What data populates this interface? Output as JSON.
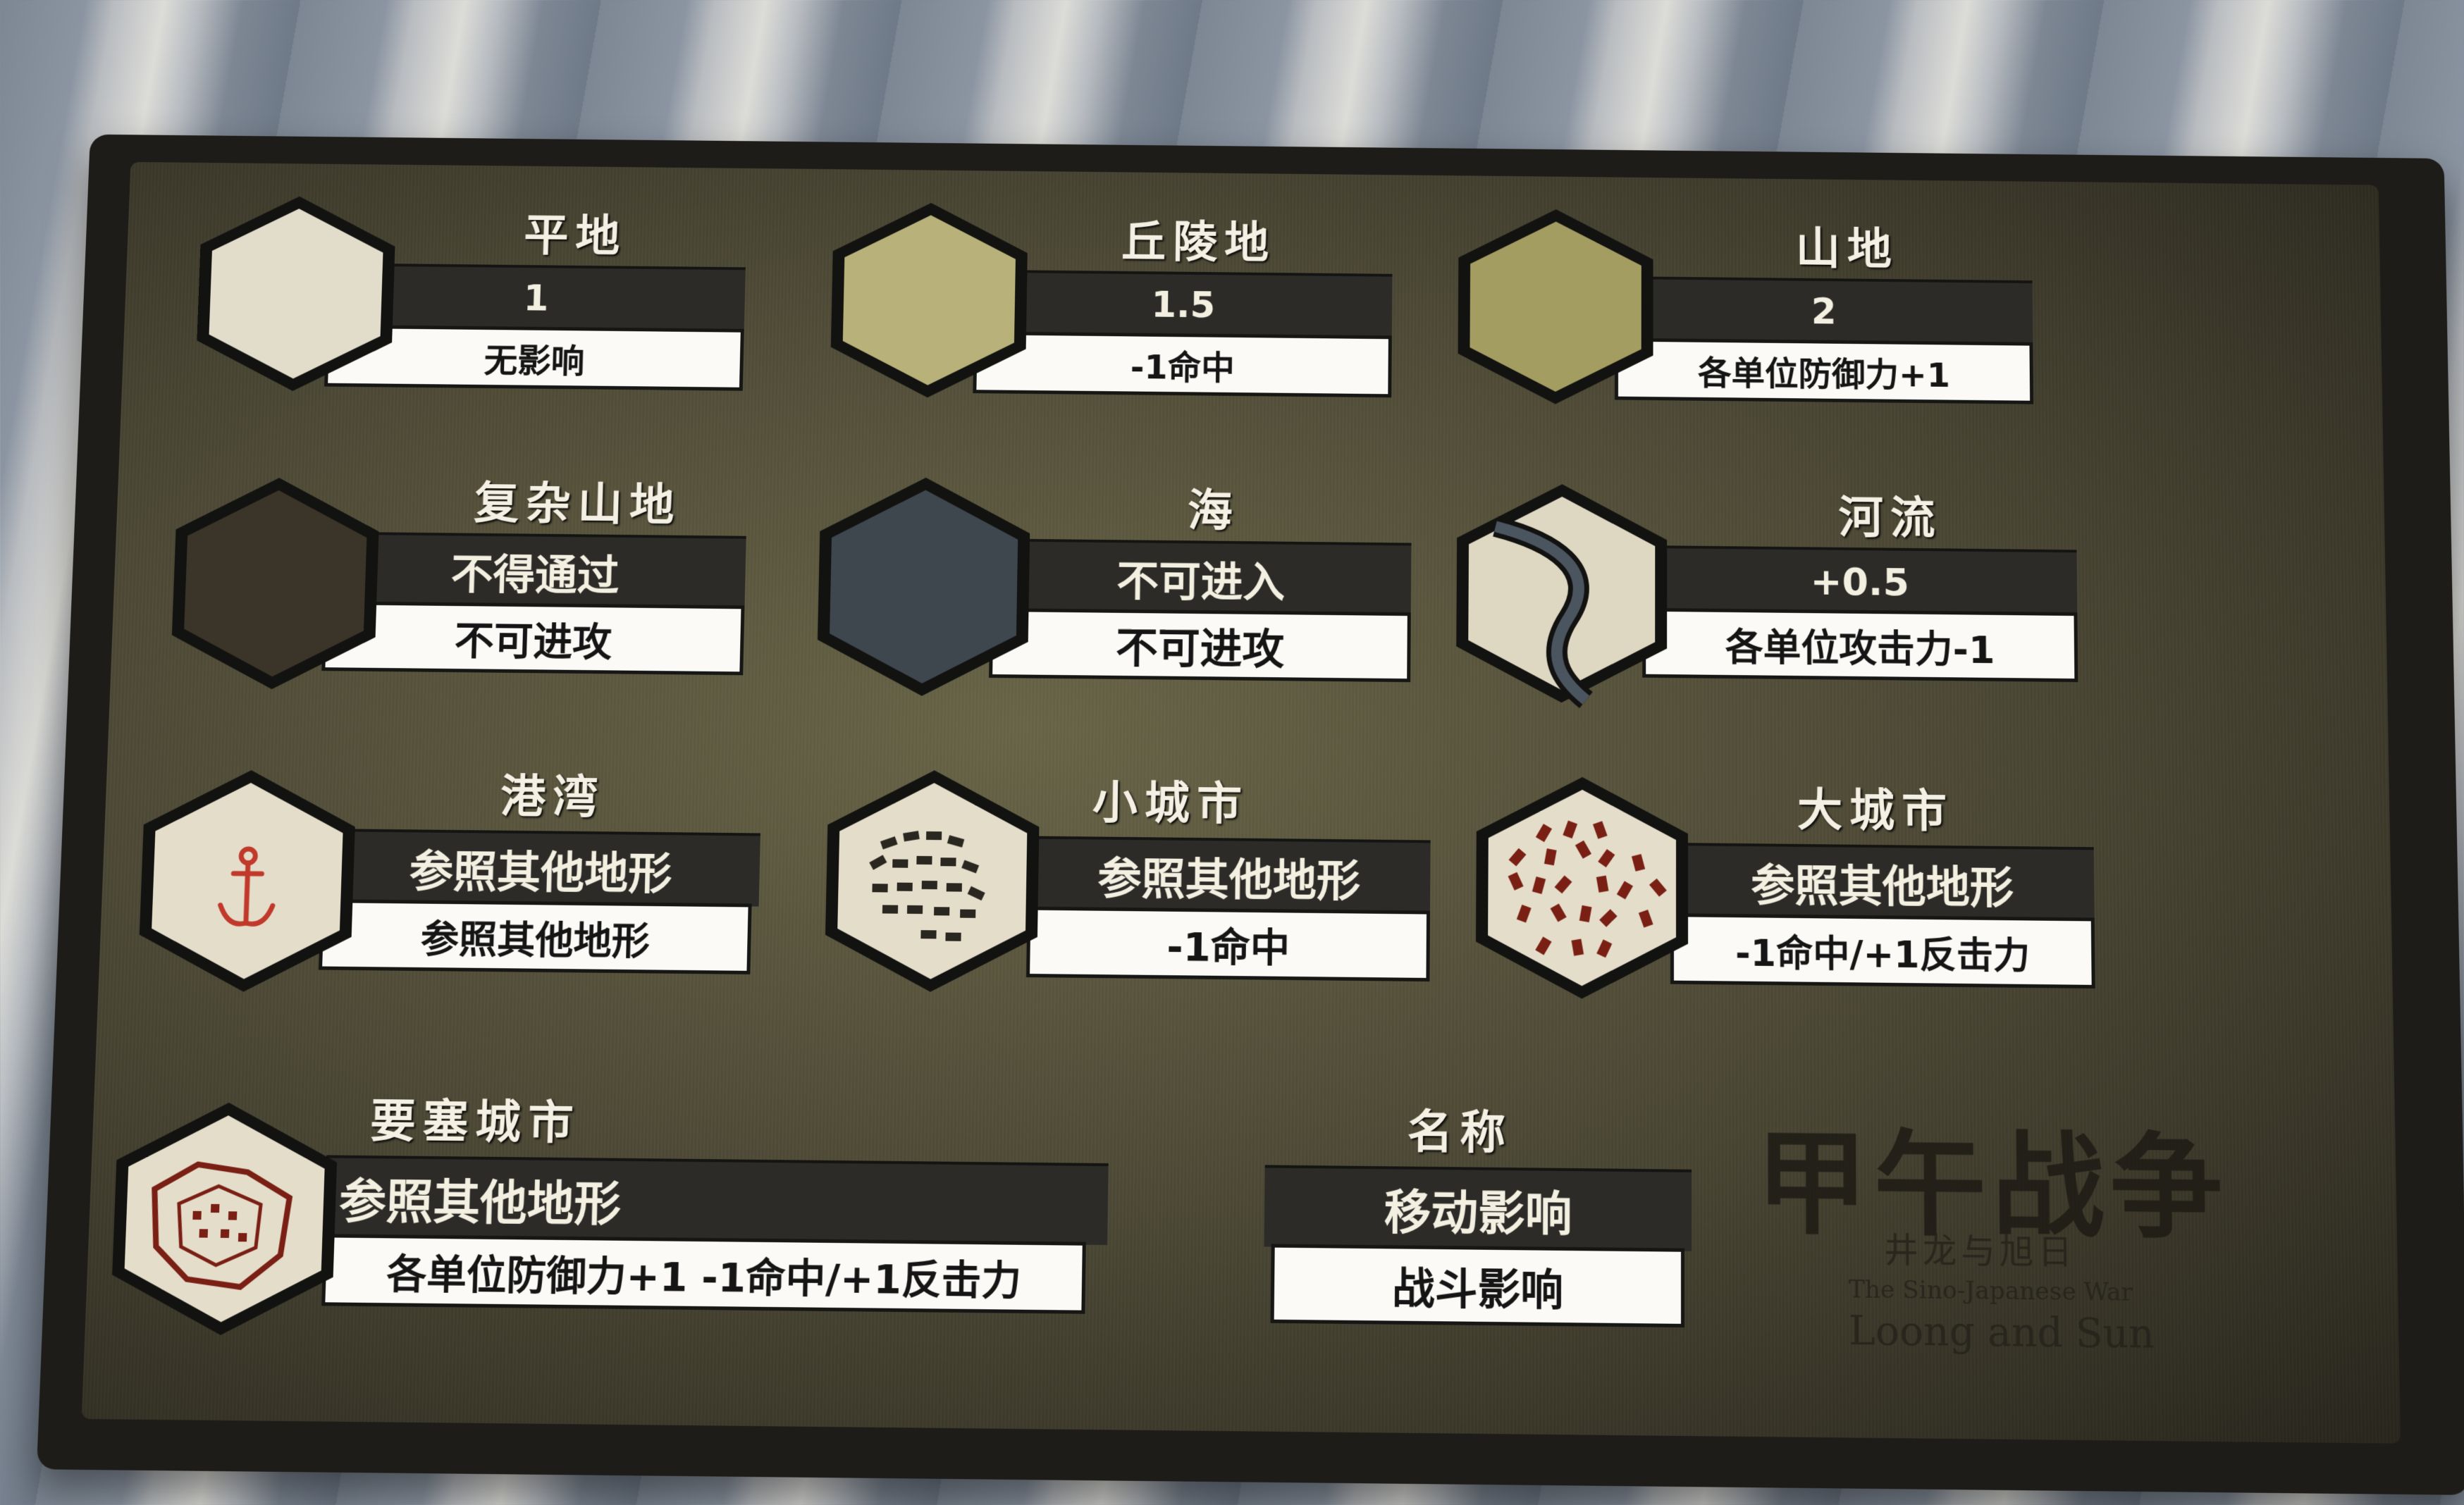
{
  "terrains": [
    {
      "name": "平地",
      "move": "1",
      "combat": "无影响",
      "hex_color": "#e2ddcb"
    },
    {
      "name": "丘陵地",
      "move": "1.5",
      "combat": "-1命中",
      "hex_color": "#b8b27a"
    },
    {
      "name": "山地",
      "move": "2",
      "combat": "各单位防御力+1",
      "hex_color": "#a49d62"
    },
    {
      "name": "复杂山地",
      "move": "不得通过",
      "combat": "不可进攻",
      "hex_color": "#3b3428"
    },
    {
      "name": "海",
      "move": "不可进入",
      "combat": "不可进攻",
      "hex_color": "#3f474e"
    },
    {
      "name": "河流",
      "move": "+0.5",
      "combat": "各单位攻击力-1",
      "hex_color": "#ded7c2"
    },
    {
      "name": "港湾",
      "move": "参照其他地形",
      "combat": "参照其他地形",
      "hex_color": "#e4ddca"
    },
    {
      "name": "小城市",
      "move": "参照其他地形",
      "combat": "-1命中",
      "hex_color": "#e4ddca"
    },
    {
      "name": "大城市",
      "move": "参照其他地形",
      "combat": "-1命中/+1反击力",
      "hex_color": "#e4ddca"
    },
    {
      "name": "要塞城市",
      "move": "参照其他地形",
      "combat": "各单位防御力+1 -1命中/+1反击力",
      "hex_color": "#e4ddca"
    }
  ],
  "legend": {
    "name": "名称",
    "move": "移动影响",
    "combat": "战斗影响"
  },
  "logo": {
    "title": "甲午战争",
    "subtitle": "井龙与旭日",
    "english1": "The Sino-Japanese War",
    "english2": "Loong and Sun"
  },
  "colors": {
    "anchor": "#c0392b",
    "building": "#7a1f14",
    "river": "#4b5560"
  }
}
